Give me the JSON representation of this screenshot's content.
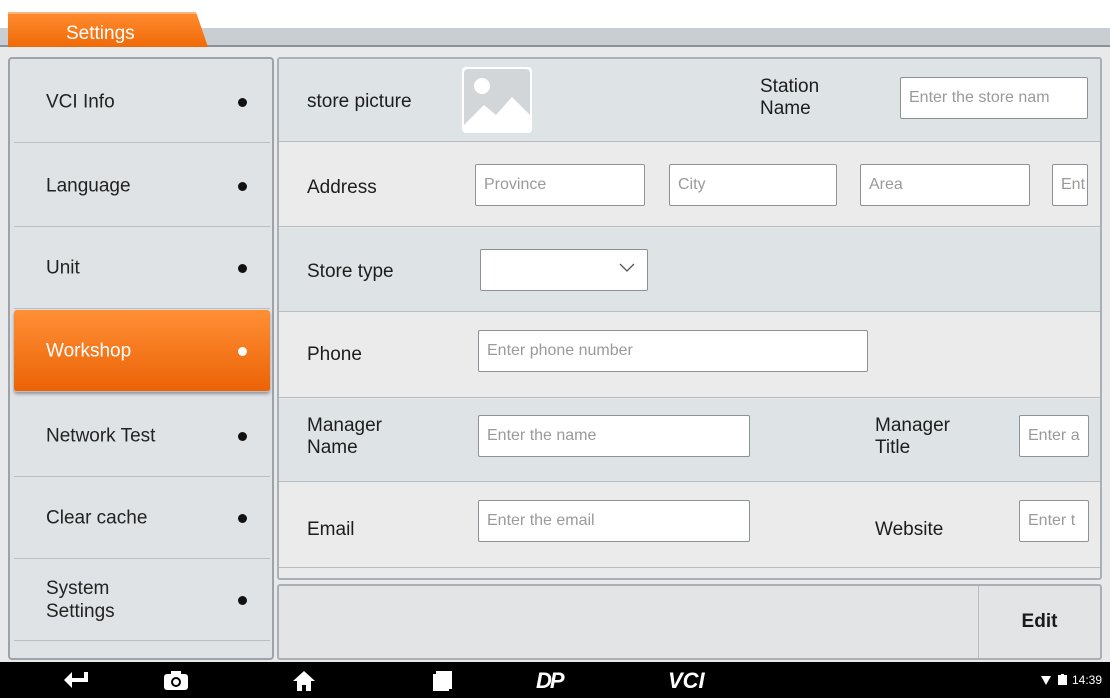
{
  "header": {
    "tab_label": "Settings"
  },
  "sidebar": {
    "items": [
      {
        "label": "VCI Info"
      },
      {
        "label": "Language"
      },
      {
        "label": "Unit"
      },
      {
        "label": "Workshop",
        "active": true
      },
      {
        "label": "Network Test"
      },
      {
        "label": "Clear cache"
      },
      {
        "label": "System\nSettings"
      }
    ]
  },
  "form": {
    "store_picture_label": "store picture",
    "station_name_label": "Station\nName",
    "station_name_placeholder": "Enter the store nam",
    "address_label": "Address",
    "province_placeholder": "Province",
    "city_placeholder": "City",
    "area_placeholder": "Area",
    "detail_placeholder": "Ent",
    "store_type_label": "Store type",
    "store_type_value": "",
    "phone_label": "Phone",
    "phone_placeholder": "Enter phone number",
    "manager_name_label": "Manager\nName",
    "manager_name_placeholder": "Enter the name",
    "manager_title_label": "Manager\nTitle",
    "manager_title_placeholder": "Enter a",
    "email_label": "Email",
    "email_placeholder": "Enter the email",
    "website_label": "Website",
    "website_placeholder": "Enter t"
  },
  "actions": {
    "edit_label": "Edit"
  },
  "navbar": {
    "brand_logo_text": "DP",
    "vci_text": "VCI",
    "time": "14:39"
  },
  "colors": {
    "accent": "#f37414",
    "panel": "#e9eaeb",
    "row_shade": "#dee3e6"
  }
}
